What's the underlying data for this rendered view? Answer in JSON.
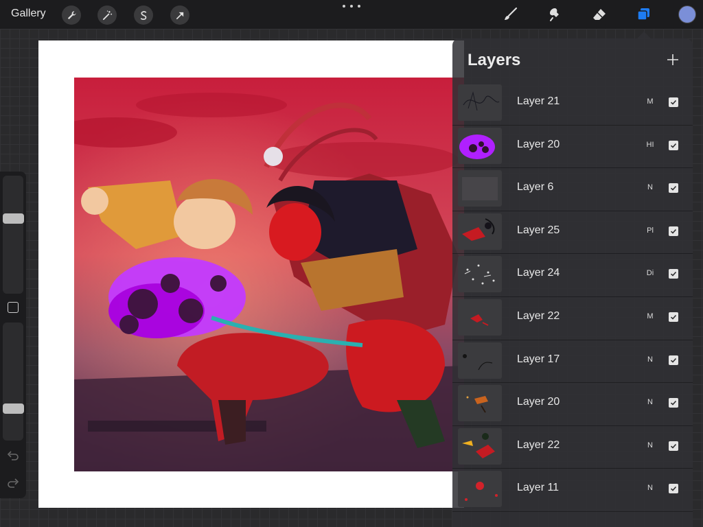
{
  "topbar": {
    "gallery_label": "Gallery",
    "left_tools": [
      {
        "name": "wrench-icon"
      },
      {
        "name": "magic-wand-icon"
      },
      {
        "name": "selection-icon"
      },
      {
        "name": "transform-arrow-icon"
      }
    ],
    "right_tools": [
      {
        "name": "brush-icon"
      },
      {
        "name": "smudge-icon"
      },
      {
        "name": "eraser-icon"
      },
      {
        "name": "layers-icon"
      }
    ],
    "active_tool": "layers-icon",
    "accent_color": "#1e7cf2",
    "current_color": "#7b8fd8"
  },
  "layers_panel": {
    "title": "Layers",
    "layers": [
      {
        "name": "Layer 21",
        "blend": "M",
        "visible": true
      },
      {
        "name": "Layer 20",
        "blend": "HI",
        "visible": true
      },
      {
        "name": "Layer 6",
        "blend": "N",
        "visible": true
      },
      {
        "name": "Layer 25",
        "blend": "Pl",
        "visible": true
      },
      {
        "name": "Layer 24",
        "blend": "Di",
        "visible": true
      },
      {
        "name": "Layer 22",
        "blend": "M",
        "visible": true
      },
      {
        "name": "Layer 17",
        "blend": "N",
        "visible": true
      },
      {
        "name": "Layer 20",
        "blend": "N",
        "visible": true
      },
      {
        "name": "Layer 22",
        "blend": "N",
        "visible": true
      },
      {
        "name": "Layer 11",
        "blend": "N",
        "visible": true
      }
    ]
  },
  "sidebar": {
    "brush_size_level": 0.65,
    "opacity_level": 0.25
  }
}
